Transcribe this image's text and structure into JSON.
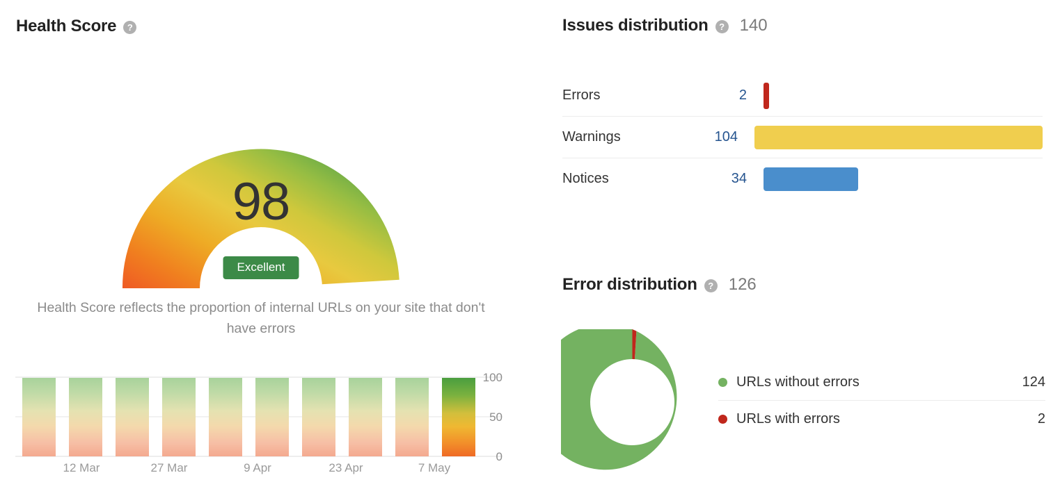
{
  "health": {
    "title": "Health Score",
    "help_icon": "question-mark-icon",
    "help_glyph": "?",
    "score": "98",
    "badge": "Excellent",
    "description": "Health Score reflects the proportion of internal URLs on your site that don't have errors",
    "badge_color": "#3c8a47"
  },
  "issues": {
    "title": "Issues distribution",
    "help_glyph": "?",
    "total": "140",
    "rows": [
      {
        "label": "Errors",
        "count": "2",
        "value": 2,
        "color": "#c0271c"
      },
      {
        "label": "Warnings",
        "count": "104",
        "value": 104,
        "color": "#f0ce4e"
      },
      {
        "label": "Notices",
        "count": "34",
        "value": 34,
        "color": "#4a8ecc"
      }
    ]
  },
  "error_distribution": {
    "title": "Error distribution",
    "help_glyph": "?",
    "total": "126",
    "legend": [
      {
        "label": "URLs without errors",
        "value": "124",
        "color": "#74b261"
      },
      {
        "label": "URLs with errors",
        "value": "2",
        "color": "#c0271c"
      }
    ]
  },
  "chart_data": [
    {
      "type": "bar",
      "title": "Health Score history",
      "xlabel": "",
      "ylabel": "",
      "ylim": [
        0,
        100
      ],
      "yticks": [
        "100",
        "50",
        "0"
      ],
      "grid": true,
      "categories": [
        "",
        "12 Mar",
        "",
        "27 Mar",
        "",
        "9 Apr",
        "",
        "23 Apr",
        "",
        "7 May"
      ],
      "xtick_labels": [
        "12 Mar",
        "27 Mar",
        "9 Apr",
        "23 Apr",
        "7 May"
      ],
      "values": [
        100,
        100,
        100,
        100,
        100,
        100,
        100,
        100,
        100,
        100
      ],
      "highlight_index": 9,
      "bar_gradient": [
        "#4a9e3f",
        "#e8c93f",
        "#ef6a25"
      ],
      "bar_gradient_faded": [
        "#bcdcb0",
        "#ece6b3",
        "#f6bda4"
      ]
    },
    {
      "type": "pie",
      "title": "Error distribution",
      "labels": [
        "URLs without errors",
        "URLs with errors"
      ],
      "values": [
        124,
        2
      ],
      "colors": [
        "#74b261",
        "#c0271c"
      ],
      "donut": true,
      "legend": "right"
    },
    {
      "type": "bar",
      "title": "Issues distribution",
      "orientation": "horizontal",
      "categories": [
        "Errors",
        "Warnings",
        "Notices"
      ],
      "values": [
        2,
        104,
        34
      ],
      "colors": [
        "#c0271c",
        "#f0ce4e",
        "#4a8ecc"
      ],
      "total": 140
    },
    {
      "type": "gauge",
      "title": "Health Score",
      "value": 98,
      "min": 0,
      "max": 100,
      "label": "Excellent"
    }
  ]
}
